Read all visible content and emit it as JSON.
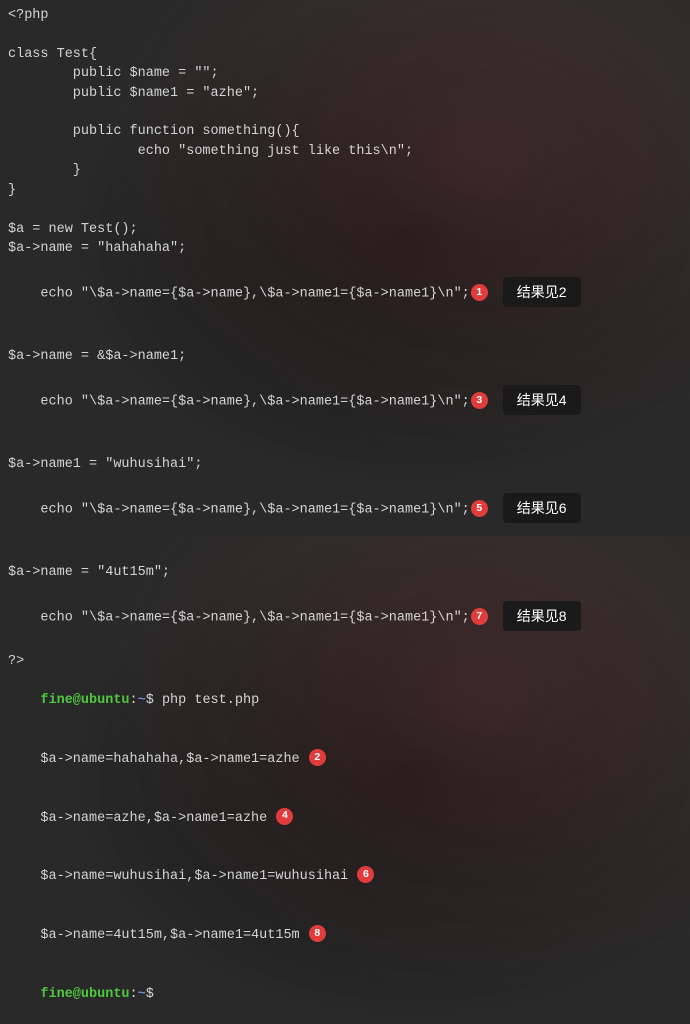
{
  "code": {
    "l1": "<?php",
    "l2": "class Test{",
    "l3": "        public $name = \"\";",
    "l4": "        public $name1 = \"azhe\";",
    "l5": "        public function something(){",
    "l6": "                echo \"something just like this\\n\";",
    "l7": "        }",
    "l8": "}",
    "l9": "$a = new Test();",
    "l10": "$a->name = \"hahahaha\";",
    "l11": "echo \"\\$a->name={$a->name},\\$a->name1={$a->name1}\\n\";",
    "l12": "$a->name = &$a->name1;",
    "l13": "echo \"\\$a->name={$a->name},\\$a->name1={$a->name1}\\n\";",
    "l14": "$a->name1 = \"wuhusihai\";",
    "l15": "echo \"\\$a->name={$a->name},\\$a->name1={$a->name1}\\n\";",
    "l16": "$a->name = \"4ut15m\";",
    "l17": "echo \"\\$a->name={$a->name},\\$a->name1={$a->name1}\\n\";",
    "l18": "?>"
  },
  "badges": {
    "b1": "1",
    "b2": "2",
    "b3": "3",
    "b4": "4",
    "b5": "5",
    "b6": "6",
    "b7": "7",
    "b8": "8"
  },
  "tooltips": {
    "t1": "结果见2",
    "t3": "结果见4",
    "t5": "结果见6",
    "t7": "结果见8"
  },
  "term": {
    "prompt_user": "fine@ubuntu",
    "prompt_sep": ":",
    "prompt_path": "~",
    "prompt_dollar": "$ ",
    "cmd": "php test.php",
    "out1": "$a->name=hahahaha,$a->name1=azhe",
    "out2": "$a->name=azhe,$a->name1=azhe",
    "out3": "$a->name=wuhusihai,$a->name1=wuhusihai",
    "out4": "$a->name=4ut15m,$a->name1=4ut15m"
  }
}
